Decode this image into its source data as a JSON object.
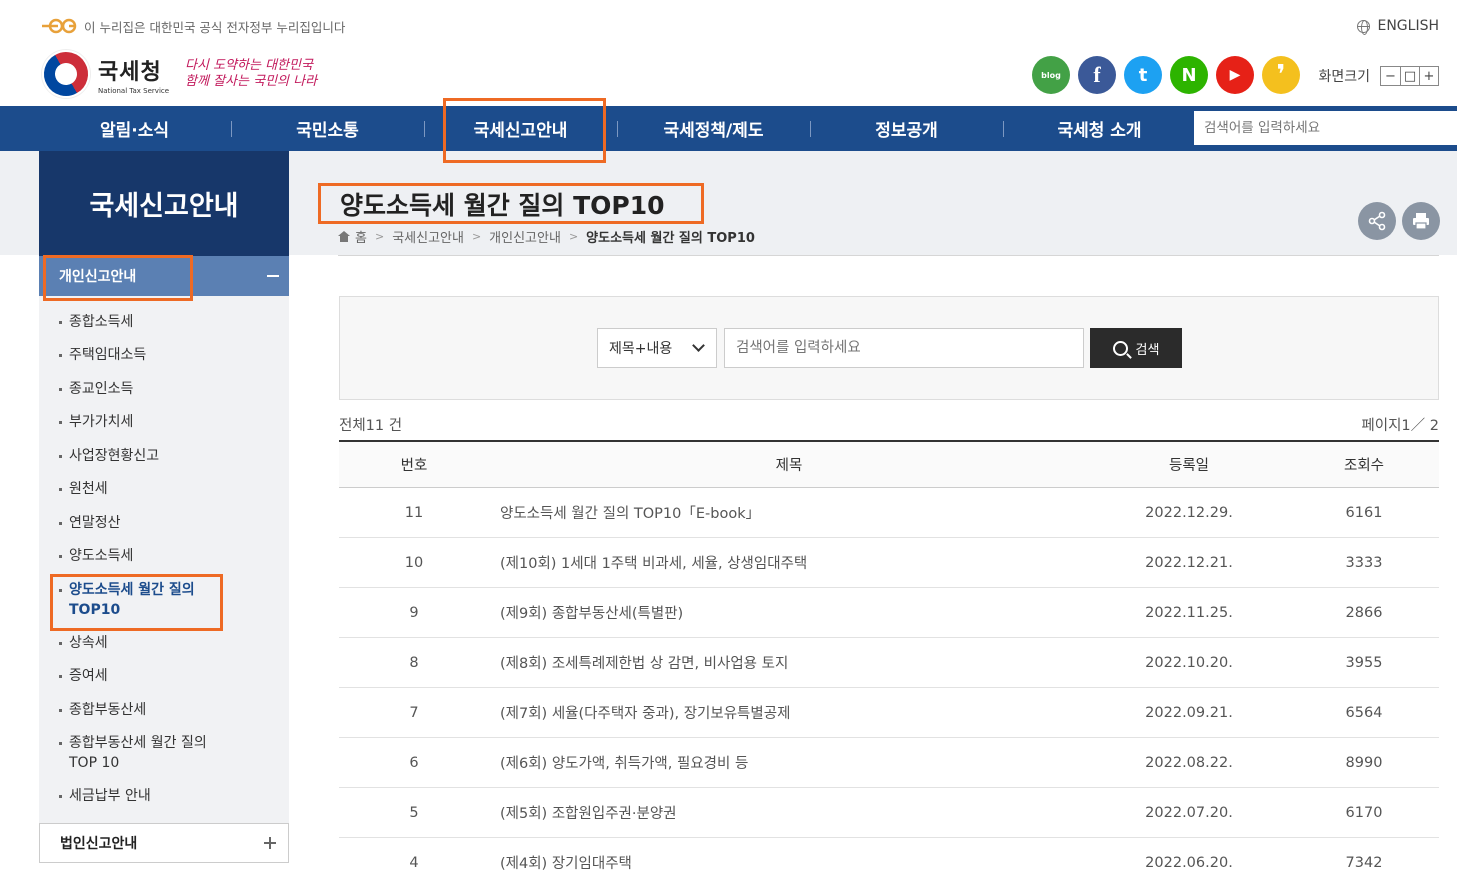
{
  "gov_banner": {
    "logo": "eg-logo",
    "text": "이 누리집은 대한민국 공식 전자정부 누리집입니다"
  },
  "lang_link": "ENGLISH",
  "logo": {
    "ko": "국세청",
    "en": "National Tax Service",
    "slogan": "다시 도약하는 대한민국 함께 잘사는 국민의 나라"
  },
  "sns": [
    {
      "name": "blog",
      "label": "blog",
      "color": "#43a146"
    },
    {
      "name": "facebook",
      "label": "f",
      "color": "#3b5998"
    },
    {
      "name": "twitter",
      "label": "t",
      "color": "#1da1f2"
    },
    {
      "name": "naver-post",
      "label": "N",
      "color": "#2db400"
    },
    {
      "name": "youtube",
      "label": "▶",
      "color": "#e62117"
    },
    {
      "name": "kakao",
      "label": "❜",
      "color": "#f4c01e"
    }
  ],
  "zoom": {
    "label": "화면크기",
    "minus": "−",
    "reset": "□",
    "plus": "+"
  },
  "gnb": {
    "items": [
      "알림·소식",
      "국민소통",
      "국세신고안내",
      "국세정책/제도",
      "정보공개",
      "국세청 소개"
    ],
    "search_placeholder": "검색어를 입력하세요"
  },
  "sidebar": {
    "title": "국세신고안내",
    "group": "개인신고안내",
    "items": [
      "종합소득세",
      "주택임대소득",
      "종교인소득",
      "부가가치세",
      "사업장현황신고",
      "원천세",
      "연말정산",
      "양도소득세",
      "양도소득세 월간 질의 TOP10",
      "상속세",
      "증여세",
      "종합부동산세",
      "종합부동산세 월간 질의 TOP 10",
      "세금납부 안내"
    ],
    "group2": "법인신고안내"
  },
  "page": {
    "title": "양도소득세 월간 질의 TOP10",
    "breadcrumb": [
      "홈",
      "국세신고안내",
      "개인신고안내",
      "양도소득세 월간 질의 TOP10"
    ]
  },
  "search": {
    "scope": "제목+내용",
    "placeholder": "검색어를 입력하세요",
    "button": "검색"
  },
  "list": {
    "total": "전체11 건",
    "page_info": "페이지1／ 2",
    "headers": [
      "번호",
      "제목",
      "등록일",
      "조회수"
    ],
    "rows": [
      {
        "no": "11",
        "title": "양도소득세 월간 질의 TOP10「E-book」",
        "date": "2022.12.29.",
        "views": "6161"
      },
      {
        "no": "10",
        "title": "(제10회) 1세대 1주택 비과세, 세율, 상생임대주택",
        "date": "2022.12.21.",
        "views": "3333"
      },
      {
        "no": "9",
        "title": "(제9회) 종합부동산세(특별판)",
        "date": "2022.11.25.",
        "views": "2866"
      },
      {
        "no": "8",
        "title": "(제8회) 조세특례제한법 상 감면, 비사업용 토지",
        "date": "2022.10.20.",
        "views": "3955"
      },
      {
        "no": "7",
        "title": "(제7회) 세율(다주택자 중과), 장기보유특별공제",
        "date": "2022.09.21.",
        "views": "6564"
      },
      {
        "no": "6",
        "title": "(제6회) 양도가액, 취득가액, 필요경비 등",
        "date": "2022.08.22.",
        "views": "8990"
      },
      {
        "no": "5",
        "title": "(제5회) 조합원입주권·분양권",
        "date": "2022.07.20.",
        "views": "6170"
      },
      {
        "no": "4",
        "title": "(제4회) 장기임대주택",
        "date": "2022.06.20.",
        "views": "7342"
      }
    ]
  },
  "colors": {
    "nav": "#1c4c8c",
    "sidebar_title": "#17376a",
    "sidebar_group": "#5b80b3",
    "highlight": "#ee6a24"
  }
}
